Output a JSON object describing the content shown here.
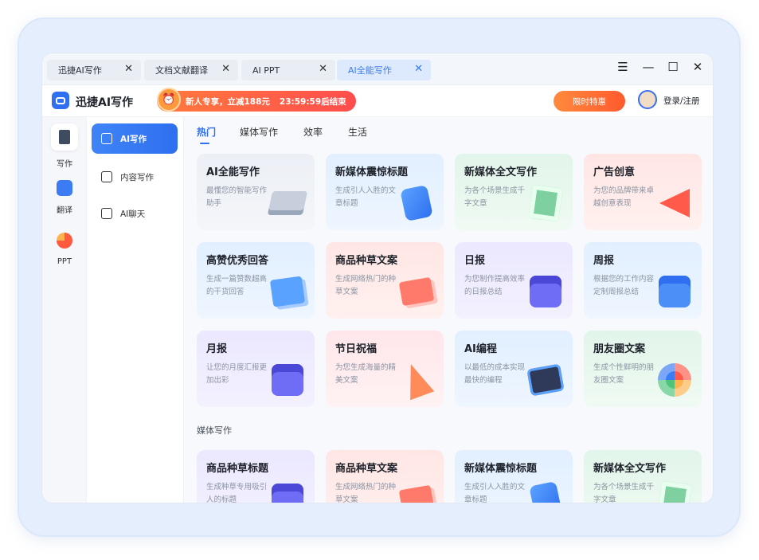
{
  "tabs": [
    {
      "label": "迅捷AI写作",
      "close": "✕"
    },
    {
      "label": "文档文献翻译",
      "close": "✕"
    },
    {
      "label": "AI PPT",
      "close": "✕"
    },
    {
      "label": "AI全能写作",
      "close": "✕"
    }
  ],
  "window_controls": {
    "menu": "☰",
    "minimize": "—",
    "maximize": "☐",
    "close": "✕"
  },
  "header": {
    "app_title": "迅捷AI写作",
    "promo_text": "新人专享，立减188元",
    "promo_timer": "23:59:59后结束",
    "deal_label": "限时特惠",
    "login_label": "登录/注册"
  },
  "rail": [
    {
      "label": "写作"
    },
    {
      "label": "翻译"
    },
    {
      "label": "PPT"
    }
  ],
  "nav2": [
    {
      "label": "AI写作"
    },
    {
      "label": "内容写作"
    },
    {
      "label": "AI聊天"
    }
  ],
  "content_tabs": [
    "热门",
    "媒体写作",
    "效率",
    "生活"
  ],
  "cards": [
    {
      "title": "AI全能写作",
      "desc": "最懂您的智能写作助手"
    },
    {
      "title": "新媒体震惊标题",
      "desc": "生成引人入胜的文章标题"
    },
    {
      "title": "新媒体全文写作",
      "desc": "为各个场景生成千字文章"
    },
    {
      "title": "广告创意",
      "desc": "为您的品牌带来卓越创意表现"
    },
    {
      "title": "高赞优秀回答",
      "desc": "生成一篇赞数超高的干货回答"
    },
    {
      "title": "商品种草文案",
      "desc": "生成网络热门的种草文案"
    },
    {
      "title": "日报",
      "desc": "为您制作提高效率的日报总结"
    },
    {
      "title": "周报",
      "desc": "根据您的工作内容定制周报总结"
    },
    {
      "title": "月报",
      "desc": "让您的月度汇报更加出彩"
    },
    {
      "title": "节日祝福",
      "desc": "为您生成海量的精美文案"
    },
    {
      "title": "AI编程",
      "desc": "以最低的成本实现最快的编程"
    },
    {
      "title": "朋友圈文案",
      "desc": "生成个性鲜明的朋友圈文案"
    }
  ],
  "section_title": "媒体写作",
  "media_cards": [
    {
      "title": "商品种草标题",
      "desc": "生成种草专用吸引人的标题"
    },
    {
      "title": "商品种草文案",
      "desc": "生成网络热门的种草文案"
    },
    {
      "title": "新媒体震惊标题",
      "desc": "生成引人入胜的文章标题"
    },
    {
      "title": "新媒体全文写作",
      "desc": "为各个场景生成千字文章"
    }
  ],
  "colors": {
    "accent": "#2f6ff0",
    "promo": "#ff5a3d"
  }
}
